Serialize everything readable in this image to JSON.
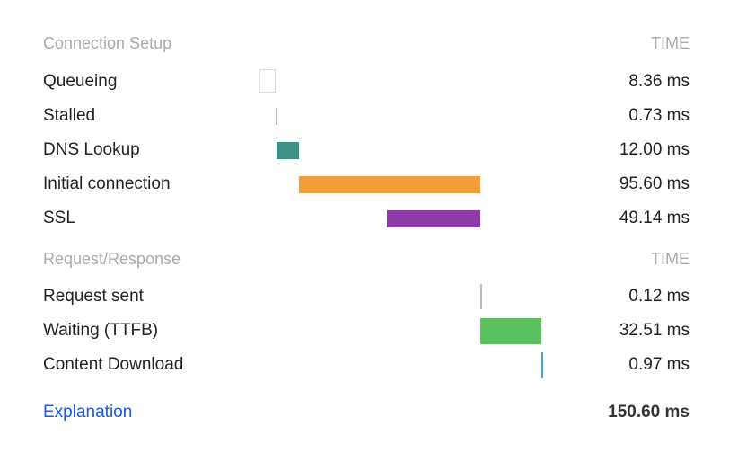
{
  "sections": [
    {
      "header": "Connection Setup",
      "time_header": "TIME",
      "rows": [
        {
          "label": "Queueing",
          "time": "8.36 ms",
          "start_ms": 0,
          "duration_ms": 8.36,
          "color": "#ffffff",
          "border": "#dddddd"
        },
        {
          "label": "Stalled",
          "time": "0.73 ms",
          "start_ms": 8.36,
          "duration_ms": 0.73,
          "color": "#bbbbbb"
        },
        {
          "label": "DNS Lookup",
          "time": "12.00 ms",
          "start_ms": 9.09,
          "duration_ms": 12.0,
          "color": "#3b9184"
        },
        {
          "label": "Initial connection",
          "time": "95.60 ms",
          "start_ms": 21.09,
          "duration_ms": 95.6,
          "color": "#f29d38"
        },
        {
          "label": "SSL",
          "time": "49.14 ms",
          "start_ms": 67.55,
          "duration_ms": 49.14,
          "color": "#8e3aa8"
        }
      ]
    },
    {
      "header": "Request/Response",
      "time_header": "TIME",
      "rows": [
        {
          "label": "Request sent",
          "time": "0.12 ms",
          "start_ms": 116.69,
          "duration_ms": 0.12,
          "color": "#bbbbbb"
        },
        {
          "label": "Waiting (TTFB)",
          "time": "32.51 ms",
          "start_ms": 116.81,
          "duration_ms": 32.51,
          "color": "#5bc15f"
        },
        {
          "label": "Content Download",
          "time": "0.97 ms",
          "start_ms": 149.32,
          "duration_ms": 0.97,
          "color": "#4a9fe0"
        }
      ]
    }
  ],
  "footer": {
    "explanation_link": "Explanation",
    "total": "150.60 ms"
  },
  "total_ms": 150.6
}
